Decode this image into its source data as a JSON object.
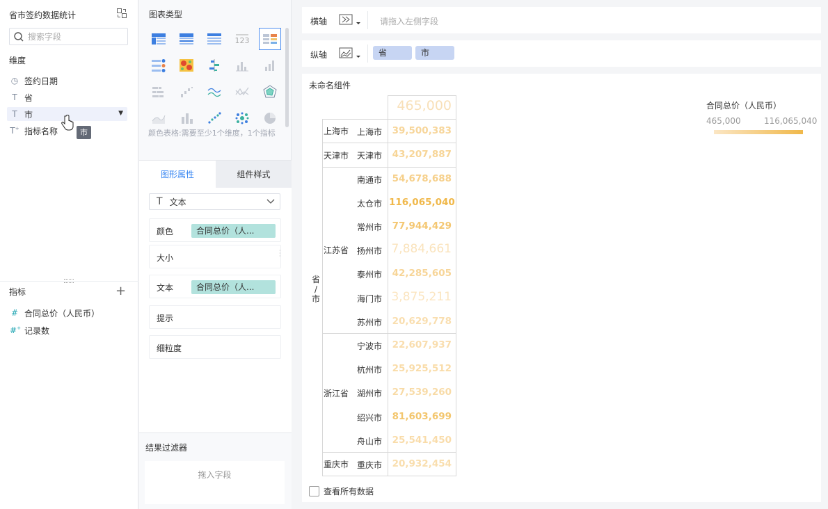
{
  "left": {
    "title": "省市签约数据统计",
    "search_placeholder": "搜索字段",
    "dimension_label": "维度",
    "dimensions": [
      {
        "label": "签约日期",
        "icon": "clock-icon"
      },
      {
        "label": "省",
        "icon": "text-type-icon"
      },
      {
        "label": "市",
        "icon": "text-type-icon"
      },
      {
        "label": "指标名称",
        "icon": "text-type-icon"
      }
    ],
    "tooltip": "市",
    "measure_label": "指标",
    "measures": [
      {
        "label": "合同总价（人民币）",
        "icon": "hash-icon"
      },
      {
        "label": "记录数",
        "icon": "hash-icon"
      }
    ]
  },
  "middle": {
    "chart_types_label": "图表类型",
    "hint": "颜色表格:需要至少1个维度，1个指标",
    "tabs": [
      "图形属性",
      "组件样式"
    ],
    "type_select": "文本",
    "props": [
      {
        "label": "颜色",
        "value": "合同总价（人..."
      },
      {
        "label": "大小",
        "value": ""
      },
      {
        "label": "文本",
        "value": "合同总价（人..."
      },
      {
        "label": "提示",
        "value": ""
      },
      {
        "label": "细粒度",
        "value": ""
      }
    ],
    "filter_label": "结果过滤器",
    "filter_drop": "拖入字段"
  },
  "right": {
    "x_axis_label": "横轴",
    "x_axis_placeholder": "请拖入左侧字段",
    "y_axis_label": "纵轴",
    "y_axis_chips": [
      "省",
      "市"
    ],
    "component_name": "未命名组件",
    "view_all": "查看所有数据",
    "legend": {
      "title": "合同总价（人民币）",
      "min": "465,000",
      "max": "116,065,040",
      "color_low": "#fbe6c4",
      "color_high": "#f0b84a"
    },
    "row_header": "省/市"
  },
  "chart_data": {
    "type": "table",
    "header_value": "465,000",
    "groups": [
      {
        "province": "上海市",
        "rows": [
          {
            "city": "上海市",
            "value": "39,500,383",
            "num": 39500383
          }
        ]
      },
      {
        "province": "天津市",
        "rows": [
          {
            "city": "天津市",
            "value": "43,207,887",
            "num": 43207887
          }
        ]
      },
      {
        "province": "江苏省",
        "rows": [
          {
            "city": "南通市",
            "value": "54,678,688",
            "num": 54678688
          },
          {
            "city": "太仓市",
            "value": "116,065,040",
            "num": 116065040
          },
          {
            "city": "常州市",
            "value": "77,944,429",
            "num": 77944429
          },
          {
            "city": "扬州市",
            "value": "7,884,661",
            "num": 7884661
          },
          {
            "city": "泰州市",
            "value": "42,285,605",
            "num": 42285605
          },
          {
            "city": "海门市",
            "value": "3,875,211",
            "num": 3875211
          },
          {
            "city": "苏州市",
            "value": "20,629,778",
            "num": 20629778
          }
        ]
      },
      {
        "province": "浙江省",
        "rows": [
          {
            "city": "宁波市",
            "value": "22,607,937",
            "num": 22607937
          },
          {
            "city": "杭州市",
            "value": "25,925,512",
            "num": 25925512
          },
          {
            "city": "湖州市",
            "value": "27,539,260",
            "num": 27539260
          },
          {
            "city": "绍兴市",
            "value": "81,603,699",
            "num": 81603699
          },
          {
            "city": "舟山市",
            "value": "25,541,450",
            "num": 25541450
          }
        ]
      },
      {
        "province": "重庆市",
        "rows": [
          {
            "city": "重庆市",
            "value": "20,932,454",
            "num": 20932454
          }
        ]
      }
    ]
  }
}
